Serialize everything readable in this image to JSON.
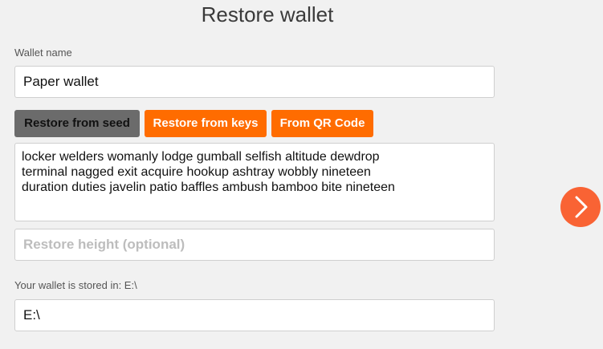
{
  "page": {
    "title": "Restore wallet"
  },
  "wallet_name": {
    "label": "Wallet name",
    "value": "Paper wallet"
  },
  "restore_tabs": [
    {
      "label": "Restore from seed",
      "selected": true
    },
    {
      "label": "Restore from keys",
      "selected": false
    },
    {
      "label": "From QR Code",
      "selected": false
    }
  ],
  "seed": {
    "value": "locker welders womanly lodge gumball selfish altitude dewdrop\nterminal nagged exit acquire hookup ashtray wobbly nineteen\nduration duties javelin patio baffles ambush bamboo bite nineteen"
  },
  "restore_height": {
    "placeholder": "Restore height (optional)",
    "value": ""
  },
  "wallet_location": {
    "label": "Your wallet is stored in: E:\\",
    "value": "E:\\"
  },
  "next_button": {
    "icon": "chevron-right-icon"
  },
  "colors": {
    "accent": "#ff6c00",
    "next_button": "#f96334",
    "selected_tab": "#6b6b6b",
    "background": "#f1f1f1"
  }
}
